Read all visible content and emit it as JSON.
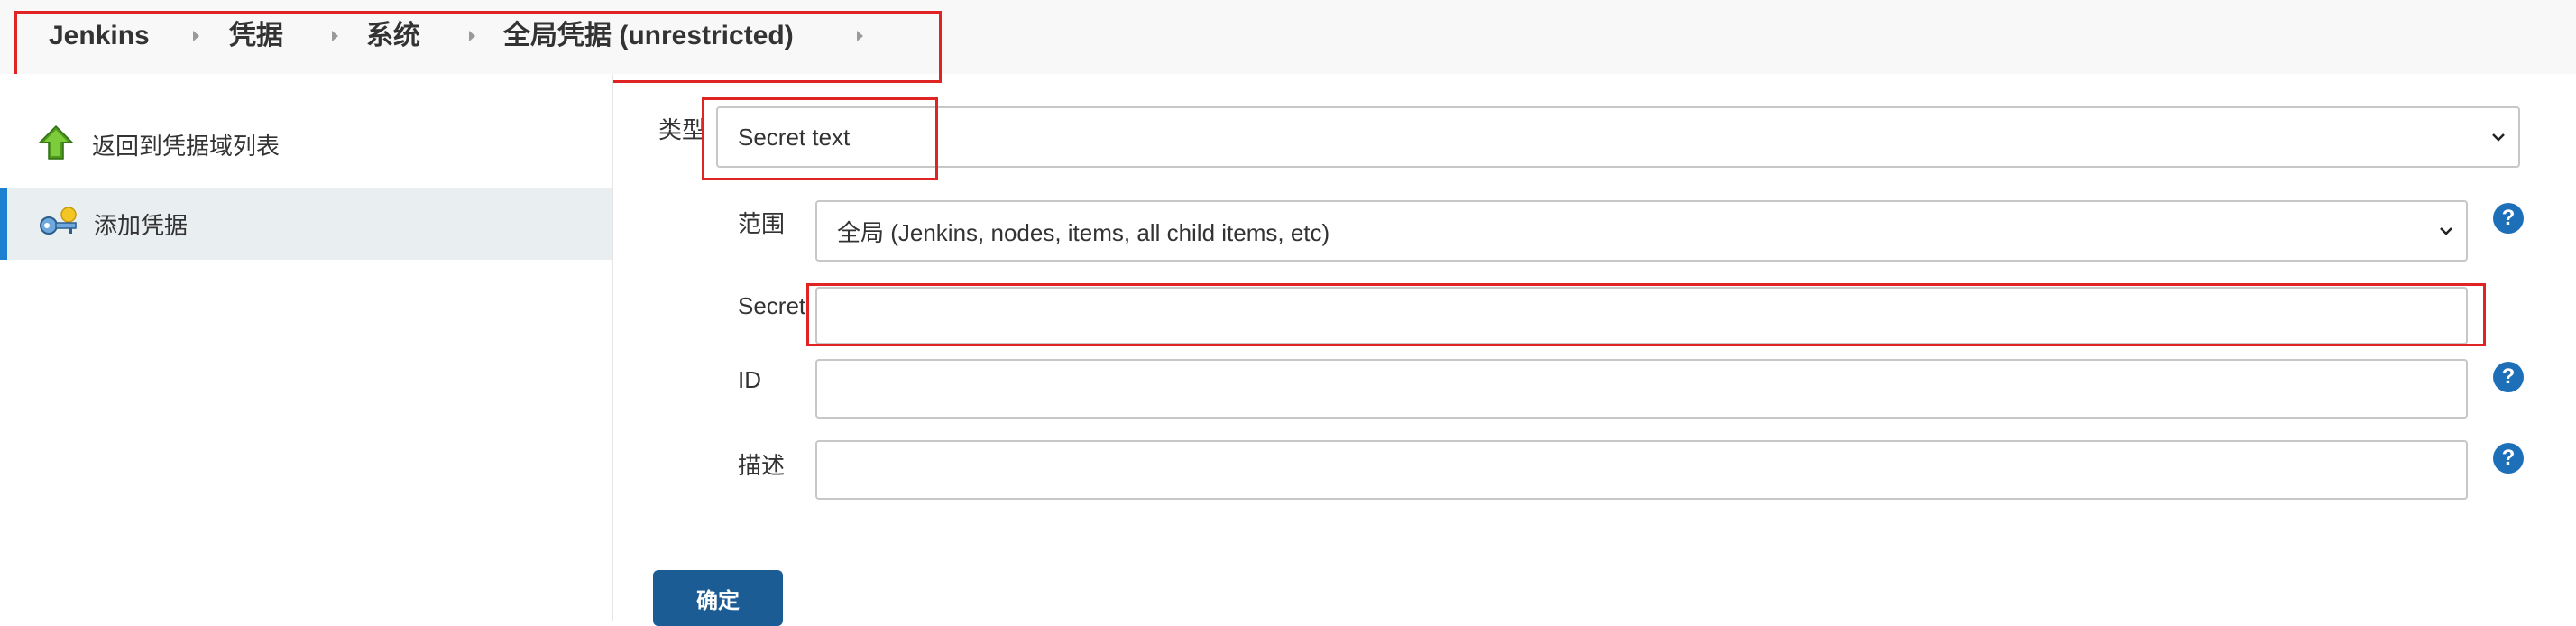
{
  "breadcrumb": {
    "items": [
      "Jenkins",
      "凭据",
      "系统",
      "全局凭据 (unrestricted)"
    ]
  },
  "sidebar": {
    "items": [
      {
        "label": "返回到凭据域列表",
        "icon": "up-arrow-icon"
      },
      {
        "label": "添加凭据",
        "icon": "key-icon"
      }
    ]
  },
  "form": {
    "kind": {
      "label": "类型",
      "value": "Secret text"
    },
    "scope": {
      "label": "范围",
      "value": "全局 (Jenkins, nodes, items, all child items, etc)"
    },
    "secret": {
      "label": "Secret",
      "value": ""
    },
    "id": {
      "label": "ID",
      "value": ""
    },
    "description": {
      "label": "描述",
      "value": ""
    },
    "submit_label": "确定",
    "help_glyph": "?"
  },
  "colors": {
    "accent": "#1d7fcf",
    "button": "#1c5c94",
    "highlight": "#e02424"
  }
}
